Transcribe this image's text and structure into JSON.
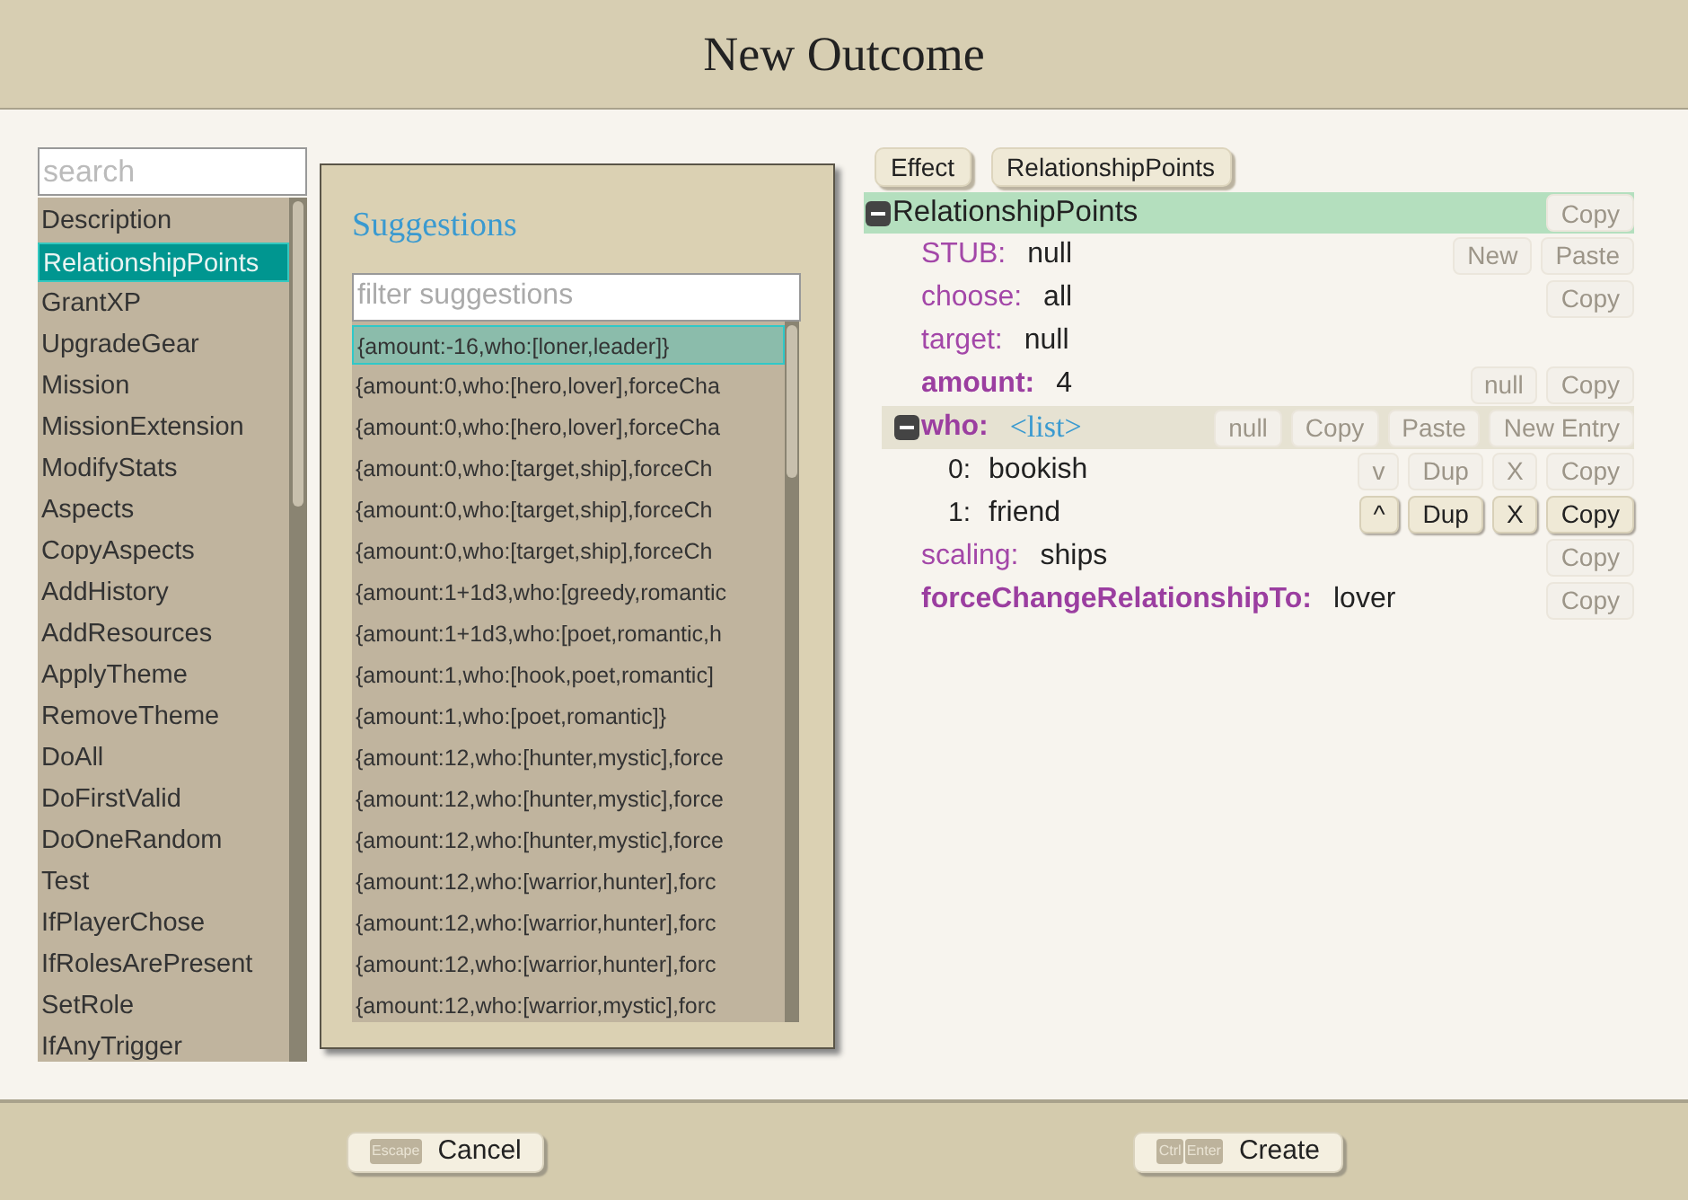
{
  "window": {
    "title": "New Outcome"
  },
  "search": {
    "placeholder": "search"
  },
  "outcome_types": [
    {
      "label": "Description",
      "selected": false
    },
    {
      "label": "RelationshipPoints",
      "selected": true
    },
    {
      "label": "GrantXP",
      "selected": false
    },
    {
      "label": "UpgradeGear",
      "selected": false
    },
    {
      "label": "Mission",
      "selected": false
    },
    {
      "label": "MissionExtension",
      "selected": false
    },
    {
      "label": "ModifyStats",
      "selected": false
    },
    {
      "label": "Aspects",
      "selected": false
    },
    {
      "label": "CopyAspects",
      "selected": false
    },
    {
      "label": "AddHistory",
      "selected": false
    },
    {
      "label": "AddResources",
      "selected": false
    },
    {
      "label": "ApplyTheme",
      "selected": false
    },
    {
      "label": "RemoveTheme",
      "selected": false
    },
    {
      "label": "DoAll",
      "selected": false
    },
    {
      "label": "DoFirstValid",
      "selected": false
    },
    {
      "label": "DoOneRandom",
      "selected": false
    },
    {
      "label": "Test",
      "selected": false
    },
    {
      "label": "IfPlayerChose",
      "selected": false
    },
    {
      "label": "IfRolesArePresent",
      "selected": false
    },
    {
      "label": "SetRole",
      "selected": false
    },
    {
      "label": "IfAnyTrigger",
      "selected": false
    }
  ],
  "suggestions": {
    "title": "Suggestions",
    "filter_placeholder": "filter suggestions",
    "items": [
      {
        "text": "{amount:-16,who:[loner,leader]}",
        "selected": true
      },
      {
        "text": "{amount:0,who:[hero,lover],forceCha",
        "selected": false
      },
      {
        "text": "{amount:0,who:[hero,lover],forceCha",
        "selected": false
      },
      {
        "text": "{amount:0,who:[target,ship],forceCh",
        "selected": false
      },
      {
        "text": "{amount:0,who:[target,ship],forceCh",
        "selected": false
      },
      {
        "text": "{amount:0,who:[target,ship],forceCh",
        "selected": false
      },
      {
        "text": "{amount:1+1d3,who:[greedy,romantic",
        "selected": false
      },
      {
        "text": "{amount:1+1d3,who:[poet,romantic,h",
        "selected": false
      },
      {
        "text": "{amount:1,who:[hook,poet,romantic]",
        "selected": false
      },
      {
        "text": "{amount:1,who:[poet,romantic]}",
        "selected": false
      },
      {
        "text": "{amount:12,who:[hunter,mystic],force",
        "selected": false
      },
      {
        "text": "{amount:12,who:[hunter,mystic],force",
        "selected": false
      },
      {
        "text": "{amount:12,who:[hunter,mystic],force",
        "selected": false
      },
      {
        "text": "{amount:12,who:[warrior,hunter],forc",
        "selected": false
      },
      {
        "text": "{amount:12,who:[warrior,hunter],forc",
        "selected": false
      },
      {
        "text": "{amount:12,who:[warrior,hunter],forc",
        "selected": false
      },
      {
        "text": "{amount:12,who:[warrior,mystic],forc",
        "selected": false
      }
    ]
  },
  "breadcrumbs": [
    "Effect",
    "RelationshipPoints"
  ],
  "tree": {
    "label": "RelationshipPoints",
    "expanded": true,
    "buttons": [
      {
        "label": "Copy",
        "faded": true
      }
    ],
    "children": [
      {
        "kind": "field",
        "key": "STUB:",
        "value": "null",
        "emphasized": false,
        "buttons": [
          {
            "label": "New",
            "faded": true
          },
          {
            "label": "Paste",
            "faded": true
          }
        ]
      },
      {
        "kind": "field",
        "key": "choose:",
        "value": "all",
        "emphasized": false,
        "buttons": [
          {
            "label": "Copy",
            "faded": true
          }
        ]
      },
      {
        "kind": "field",
        "key": "target:",
        "value": "null",
        "emphasized": false
      },
      {
        "kind": "field",
        "key": "amount:",
        "value": "4",
        "emphasized": true,
        "buttons": [
          {
            "label": "null",
            "faded": true
          },
          {
            "label": "Copy",
            "faded": true
          }
        ]
      },
      {
        "kind": "list",
        "key": "who:",
        "value": "<list>",
        "emphasized": true,
        "expanded": true,
        "buttons": [
          {
            "label": "null",
            "faded": true
          },
          {
            "label": "Copy",
            "faded": true
          },
          {
            "label": "Paste",
            "faded": true
          },
          {
            "label": "New Entry",
            "faded": true
          }
        ],
        "children": [
          {
            "kind": "entry",
            "key": "0:",
            "value": "bookish",
            "buttons": [
              {
                "label": "v",
                "faded": true
              },
              {
                "label": "Dup",
                "faded": true
              },
              {
                "label": "X",
                "faded": true
              },
              {
                "label": "Copy",
                "faded": true
              }
            ]
          },
          {
            "kind": "entry",
            "key": "1:",
            "value": "friend",
            "buttons": [
              {
                "label": "^",
                "faded": false
              },
              {
                "label": "Dup",
                "faded": false
              },
              {
                "label": "X",
                "faded": false
              },
              {
                "label": "Copy",
                "faded": false
              }
            ]
          }
        ]
      },
      {
        "kind": "field",
        "key": "scaling:",
        "value": "ships",
        "emphasized": false,
        "buttons": [
          {
            "label": "Copy",
            "faded": true
          }
        ]
      },
      {
        "kind": "field",
        "key": "forceChangeRelationshipTo:",
        "value": "lover",
        "emphasized": true,
        "buttons": [
          {
            "label": "Copy",
            "faded": true
          }
        ]
      }
    ]
  },
  "footer": {
    "cancel": {
      "label": "Cancel",
      "keys": [
        "Escape"
      ]
    },
    "create": {
      "label": "Create",
      "keys": [
        "Ctrl",
        "Enter"
      ]
    }
  }
}
